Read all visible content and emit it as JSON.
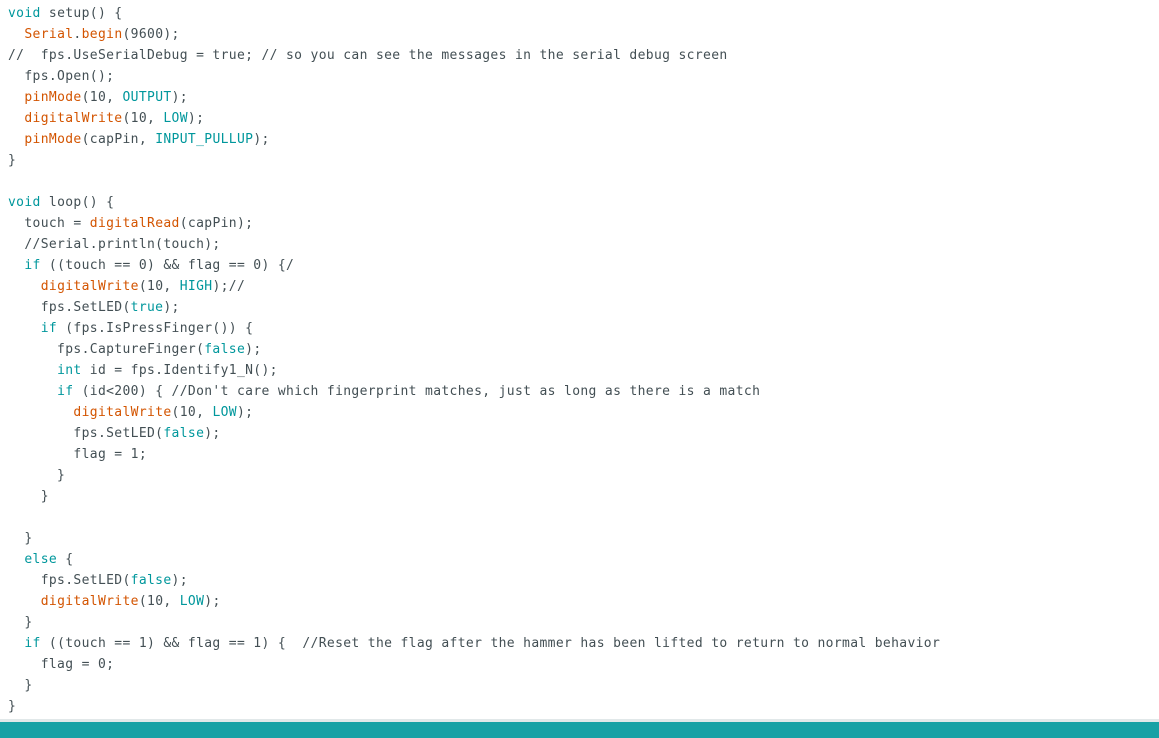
{
  "editor": {
    "colors": {
      "keyword": "#00979c",
      "function": "#d35400",
      "constant": "#00979c",
      "comment": "#434f54",
      "text": "#434f54",
      "status_bar": "#17a1a5"
    },
    "lines": [
      [
        [
          "kw",
          "void"
        ],
        [
          "pl",
          " setup() {"
        ]
      ],
      [
        [
          "pl",
          "  "
        ],
        [
          "fn",
          "Serial"
        ],
        [
          "pl",
          "."
        ],
        [
          "fn",
          "begin"
        ],
        [
          "pl",
          "(9600);"
        ]
      ],
      [
        [
          "cm",
          "//  fps.UseSerialDebug = true; // so you can see the messages in the serial debug screen"
        ]
      ],
      [
        [
          "pl",
          "  fps.Open();"
        ]
      ],
      [
        [
          "pl",
          "  "
        ],
        [
          "fn",
          "pinMode"
        ],
        [
          "pl",
          "(10, "
        ],
        [
          "cst",
          "OUTPUT"
        ],
        [
          "pl",
          ");"
        ]
      ],
      [
        [
          "pl",
          "  "
        ],
        [
          "fn",
          "digitalWrite"
        ],
        [
          "pl",
          "(10, "
        ],
        [
          "cst",
          "LOW"
        ],
        [
          "pl",
          ");"
        ]
      ],
      [
        [
          "pl",
          "  "
        ],
        [
          "fn",
          "pinMode"
        ],
        [
          "pl",
          "(capPin, "
        ],
        [
          "cst",
          "INPUT_PULLUP"
        ],
        [
          "pl",
          ");"
        ]
      ],
      [
        [
          "pl",
          "}"
        ]
      ],
      [
        [
          "pl",
          ""
        ]
      ],
      [
        [
          "kw",
          "void"
        ],
        [
          "pl",
          " loop() {"
        ]
      ],
      [
        [
          "pl",
          "  touch = "
        ],
        [
          "fn",
          "digitalRead"
        ],
        [
          "pl",
          "(capPin);"
        ]
      ],
      [
        [
          "cm",
          "  //Serial.println(touch);"
        ]
      ],
      [
        [
          "pl",
          "  "
        ],
        [
          "kw",
          "if"
        ],
        [
          "pl",
          " ((touch == 0) && flag == 0) {/"
        ]
      ],
      [
        [
          "pl",
          "    "
        ],
        [
          "fn",
          "digitalWrite"
        ],
        [
          "pl",
          "(10, "
        ],
        [
          "cst",
          "HIGH"
        ],
        [
          "pl",
          ");//"
        ]
      ],
      [
        [
          "pl",
          "    fps.SetLED("
        ],
        [
          "cst",
          "true"
        ],
        [
          "pl",
          ");"
        ]
      ],
      [
        [
          "pl",
          "    "
        ],
        [
          "kw",
          "if"
        ],
        [
          "pl",
          " (fps.IsPressFinger()) {"
        ]
      ],
      [
        [
          "pl",
          "      fps.CaptureFinger("
        ],
        [
          "cst",
          "false"
        ],
        [
          "pl",
          ");"
        ]
      ],
      [
        [
          "pl",
          "      "
        ],
        [
          "kw",
          "int"
        ],
        [
          "pl",
          " id = fps.Identify1_N();"
        ]
      ],
      [
        [
          "pl",
          "      "
        ],
        [
          "kw",
          "if"
        ],
        [
          "pl",
          " (id<200) { "
        ],
        [
          "cm",
          "//Don't care which fingerprint matches, just as long as there is a match"
        ]
      ],
      [
        [
          "pl",
          "        "
        ],
        [
          "fn",
          "digitalWrite"
        ],
        [
          "pl",
          "(10, "
        ],
        [
          "cst",
          "LOW"
        ],
        [
          "pl",
          ");"
        ]
      ],
      [
        [
          "pl",
          "        fps.SetLED("
        ],
        [
          "cst",
          "false"
        ],
        [
          "pl",
          ");"
        ]
      ],
      [
        [
          "pl",
          "        flag = 1;"
        ]
      ],
      [
        [
          "pl",
          "      }"
        ]
      ],
      [
        [
          "pl",
          "    }"
        ]
      ],
      [
        [
          "pl",
          ""
        ]
      ],
      [
        [
          "pl",
          "  }"
        ]
      ],
      [
        [
          "pl",
          "  "
        ],
        [
          "kw",
          "else"
        ],
        [
          "pl",
          " {"
        ]
      ],
      [
        [
          "pl",
          "    fps.SetLED("
        ],
        [
          "cst",
          "false"
        ],
        [
          "pl",
          ");"
        ]
      ],
      [
        [
          "pl",
          "    "
        ],
        [
          "fn",
          "digitalWrite"
        ],
        [
          "pl",
          "(10, "
        ],
        [
          "cst",
          "LOW"
        ],
        [
          "pl",
          ");"
        ]
      ],
      [
        [
          "pl",
          "  }"
        ]
      ],
      [
        [
          "pl",
          "  "
        ],
        [
          "kw",
          "if"
        ],
        [
          "pl",
          " ((touch == 1) && flag == 1) {  "
        ],
        [
          "cm",
          "//Reset the flag after the hammer has been lifted to return to normal behavior"
        ]
      ],
      [
        [
          "pl",
          "    flag = 0;"
        ]
      ],
      [
        [
          "pl",
          "  }"
        ]
      ],
      [
        [
          "pl",
          "}"
        ]
      ]
    ]
  }
}
